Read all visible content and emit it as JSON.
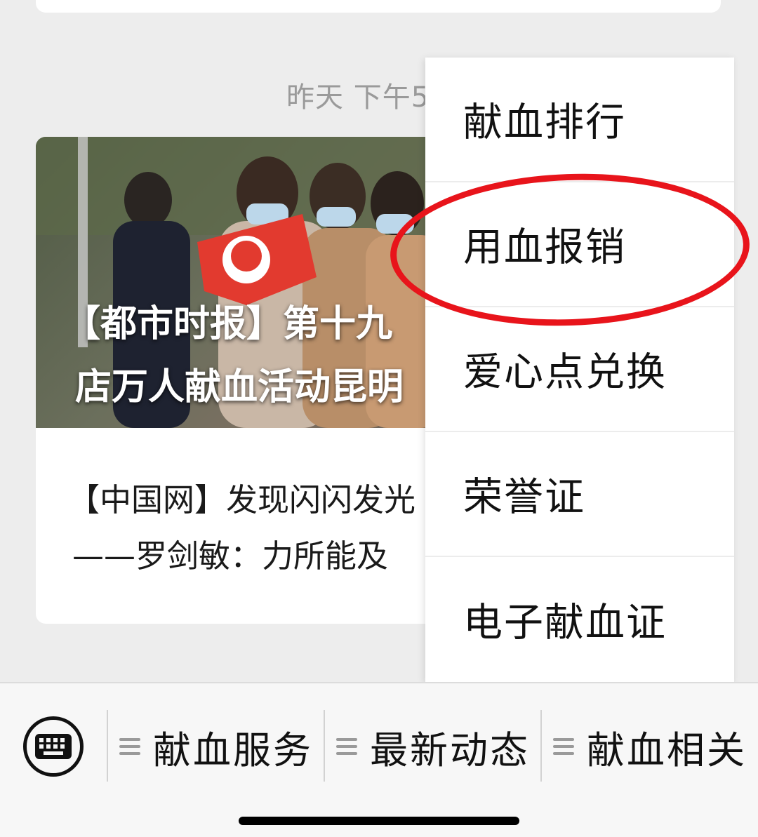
{
  "chat": {
    "timestamp": "昨天 下午5",
    "article": {
      "cover_title_line1": "【都市时报】第十九",
      "cover_title_line2": "店万人献血活动昆明",
      "sub_title_line1": "【中国网】发现闪闪发光",
      "sub_title_line2": "——罗剑敏：力所能及"
    }
  },
  "popup_menu": {
    "items": [
      {
        "label": "献血排行"
      },
      {
        "label": "用血报销"
      },
      {
        "label": "爱心点兑换"
      },
      {
        "label": "荣誉证"
      },
      {
        "label": "电子献血证"
      }
    ],
    "highlighted_item": "用血报销",
    "highlight_color": "#e8141b"
  },
  "bottom_menu": {
    "keyboard_icon": "keyboard-icon",
    "tabs": [
      {
        "label": "献血服务"
      },
      {
        "label": "最新动态"
      },
      {
        "label": "献血相关"
      }
    ]
  }
}
